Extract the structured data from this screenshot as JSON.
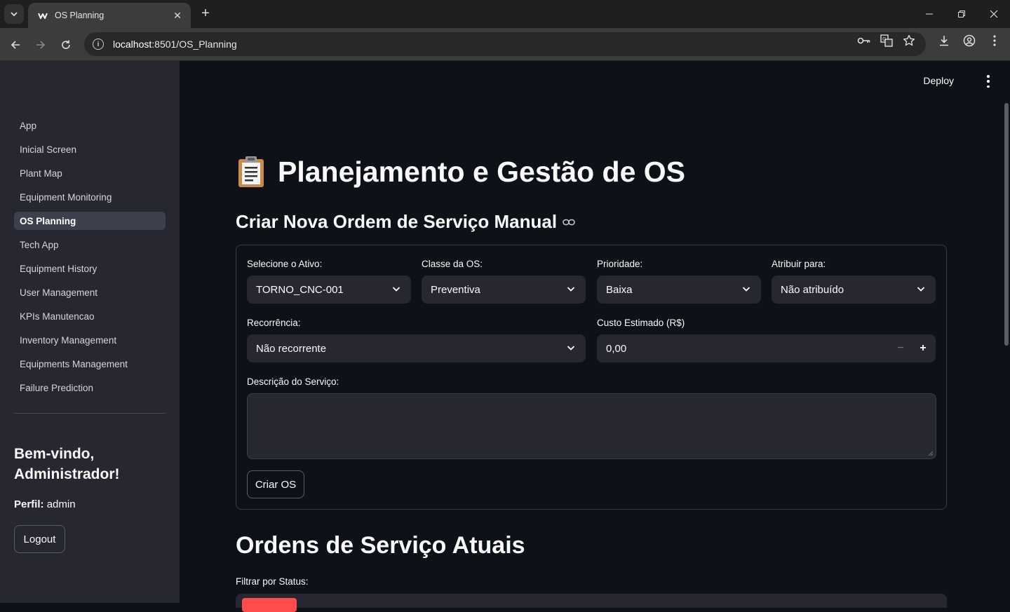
{
  "browser": {
    "tab_title": "OS Planning",
    "url_host": "localhost",
    "url_rest": ":8501/OS_Planning"
  },
  "sidebar": {
    "items": [
      {
        "label": "App"
      },
      {
        "label": "Inicial Screen"
      },
      {
        "label": "Plant Map"
      },
      {
        "label": "Equipment Monitoring"
      },
      {
        "label": "OS Planning",
        "active": true
      },
      {
        "label": "Tech App"
      },
      {
        "label": "Equipment History"
      },
      {
        "label": "User Management"
      },
      {
        "label": "KPIs Manutencao"
      },
      {
        "label": "Inventory Management"
      },
      {
        "label": "Equipments Management"
      },
      {
        "label": "Failure Prediction"
      }
    ],
    "welcome": "Bem-vindo, Administrador!",
    "profile_label": "Perfil:",
    "profile_value": "admin",
    "logout_label": "Logout"
  },
  "header": {
    "deploy_label": "Deploy"
  },
  "main": {
    "page_title": "Planejamento e Gestão de OS",
    "section_title": "Criar Nova Ordem de Serviço Manual",
    "form": {
      "asset_label": "Selecione o Ativo:",
      "asset_value": "TORNO_CNC-001",
      "class_label": "Classe da OS:",
      "class_value": "Preventiva",
      "priority_label": "Prioridade:",
      "priority_value": "Baixa",
      "assign_label": "Atribuir para:",
      "assign_value": "Não atribuído",
      "recurrence_label": "Recorrência:",
      "recurrence_value": "Não recorrente",
      "cost_label": "Custo Estimado (R$)",
      "cost_value": "0,00",
      "description_label": "Descrição do Serviço:",
      "description_value": "",
      "submit_label": "Criar OS"
    },
    "orders_title": "Ordens de Serviço Atuais",
    "filter_label": "Filtrar por Status:"
  },
  "colors": {
    "primary": "#ff4b4b",
    "sidebar_bg": "#262730",
    "main_bg": "#0e1117"
  }
}
